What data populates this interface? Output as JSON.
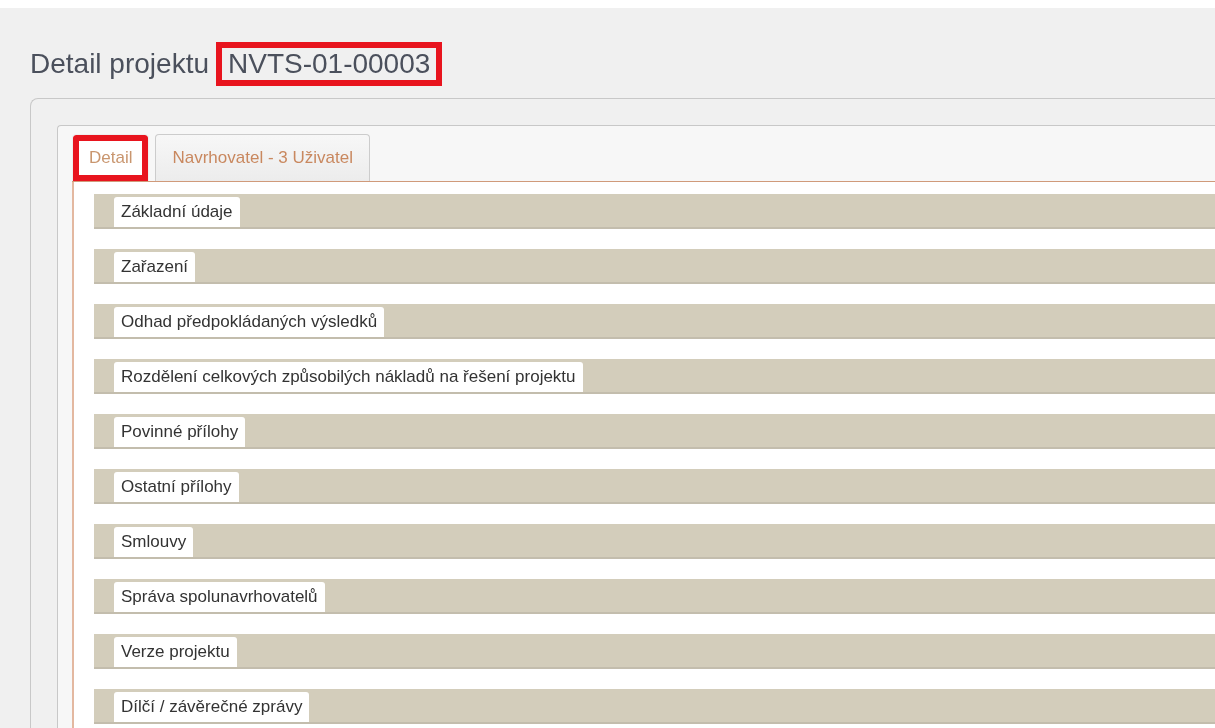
{
  "title": {
    "label": "Detail projektu",
    "code": "NVTS-01-00003",
    "code_highlighted": true
  },
  "tabs": [
    {
      "label": "Detail",
      "selected": true,
      "highlighted": true
    },
    {
      "label": "Navrhovatel - 3 Uživatel",
      "selected": false,
      "highlighted": false
    }
  ],
  "sections": [
    {
      "label": "Základní údaje"
    },
    {
      "label": "Zařazení"
    },
    {
      "label": "Odhad předpokládaných výsledků"
    },
    {
      "label": "Rozdělení celkových způsobilých nákladů na řešení projektu"
    },
    {
      "label": "Povinné přílohy"
    },
    {
      "label": "Ostatní přílohy"
    },
    {
      "label": "Smlouvy"
    },
    {
      "label": "Správa spolunavrhovatelů"
    },
    {
      "label": "Verze projektu"
    },
    {
      "label": "Dílčí / závěrečné zprávy"
    }
  ]
}
